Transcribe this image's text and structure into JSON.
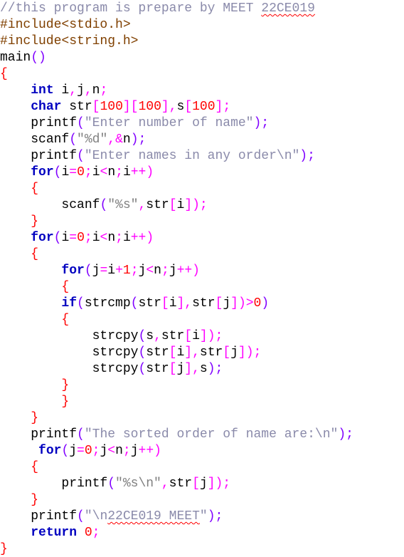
{
  "editor": {
    "lines": [
      {
        "tokens": [
          {
            "t": "//this program is prepare by MEET ",
            "c": "comment"
          },
          {
            "t": "22CE019",
            "c": "comment squiggle"
          }
        ]
      },
      {
        "tokens": [
          {
            "t": "#include<stdio.h>",
            "c": "preproc"
          }
        ]
      },
      {
        "tokens": [
          {
            "t": "#include<string.h>",
            "c": "preproc"
          }
        ]
      },
      {
        "tokens": [
          {
            "t": "main",
            "c": "ident"
          },
          {
            "t": "()",
            "c": "paren"
          }
        ]
      },
      {
        "tokens": [
          {
            "t": "{",
            "c": "brace"
          }
        ]
      },
      {
        "tokens": [
          {
            "t": "    ",
            "c": "ident"
          },
          {
            "t": "int",
            "c": "keyword"
          },
          {
            "t": " i",
            "c": "ident"
          },
          {
            "t": ",",
            "c": "op"
          },
          {
            "t": "j",
            "c": "ident"
          },
          {
            "t": ",",
            "c": "op"
          },
          {
            "t": "n",
            "c": "ident"
          },
          {
            "t": ";",
            "c": "op"
          }
        ]
      },
      {
        "tokens": [
          {
            "t": "    ",
            "c": "ident"
          },
          {
            "t": "char",
            "c": "keyword"
          },
          {
            "t": " str",
            "c": "ident"
          },
          {
            "t": "[",
            "c": "op"
          },
          {
            "t": "100",
            "c": "number"
          },
          {
            "t": "][",
            "c": "op"
          },
          {
            "t": "100",
            "c": "number"
          },
          {
            "t": "],",
            "c": "op"
          },
          {
            "t": "s",
            "c": "ident"
          },
          {
            "t": "[",
            "c": "op"
          },
          {
            "t": "100",
            "c": "number"
          },
          {
            "t": "];",
            "c": "op"
          }
        ]
      },
      {
        "tokens": [
          {
            "t": "    ",
            "c": "ident"
          },
          {
            "t": "printf",
            "c": "ident"
          },
          {
            "t": "(",
            "c": "paren"
          },
          {
            "t": "\"Enter number of name\"",
            "c": "string"
          },
          {
            "t": ");",
            "c": "paren"
          }
        ]
      },
      {
        "tokens": [
          {
            "t": "    ",
            "c": "ident"
          },
          {
            "t": "scanf",
            "c": "ident"
          },
          {
            "t": "(",
            "c": "paren"
          },
          {
            "t": "\"%d\"",
            "c": "string2"
          },
          {
            "t": ",&",
            "c": "op"
          },
          {
            "t": "n",
            "c": "ident"
          },
          {
            "t": ");",
            "c": "paren"
          }
        ]
      },
      {
        "tokens": [
          {
            "t": "    ",
            "c": "ident"
          },
          {
            "t": "printf",
            "c": "ident"
          },
          {
            "t": "(",
            "c": "paren"
          },
          {
            "t": "\"Enter names in any order\\n\"",
            "c": "string"
          },
          {
            "t": ");",
            "c": "paren"
          }
        ]
      },
      {
        "tokens": [
          {
            "t": "    ",
            "c": "ident"
          },
          {
            "t": "for",
            "c": "keyword"
          },
          {
            "t": "(",
            "c": "paren"
          },
          {
            "t": "i",
            "c": "ident"
          },
          {
            "t": "=",
            "c": "op"
          },
          {
            "t": "0",
            "c": "number"
          },
          {
            "t": ";",
            "c": "op"
          },
          {
            "t": "i",
            "c": "ident"
          },
          {
            "t": "<",
            "c": "op"
          },
          {
            "t": "n",
            "c": "ident"
          },
          {
            "t": ";",
            "c": "op"
          },
          {
            "t": "i",
            "c": "ident"
          },
          {
            "t": "++)",
            "c": "op"
          }
        ]
      },
      {
        "tokens": [
          {
            "t": "    ",
            "c": "ident"
          },
          {
            "t": "{",
            "c": "brace"
          }
        ]
      },
      {
        "tokens": [
          {
            "t": "        ",
            "c": "ident"
          },
          {
            "t": "scanf",
            "c": "ident"
          },
          {
            "t": "(",
            "c": "paren"
          },
          {
            "t": "\"%s\"",
            "c": "string2"
          },
          {
            "t": ",",
            "c": "op"
          },
          {
            "t": "str",
            "c": "ident"
          },
          {
            "t": "[",
            "c": "op"
          },
          {
            "t": "i",
            "c": "ident"
          },
          {
            "t": "]);",
            "c": "op"
          }
        ]
      },
      {
        "tokens": [
          {
            "t": "    ",
            "c": "ident"
          },
          {
            "t": "}",
            "c": "brace"
          }
        ]
      },
      {
        "tokens": [
          {
            "t": "    ",
            "c": "ident"
          },
          {
            "t": "for",
            "c": "keyword"
          },
          {
            "t": "(",
            "c": "paren"
          },
          {
            "t": "i",
            "c": "ident"
          },
          {
            "t": "=",
            "c": "op"
          },
          {
            "t": "0",
            "c": "number"
          },
          {
            "t": ";",
            "c": "op"
          },
          {
            "t": "i",
            "c": "ident"
          },
          {
            "t": "<",
            "c": "op"
          },
          {
            "t": "n",
            "c": "ident"
          },
          {
            "t": ";",
            "c": "op"
          },
          {
            "t": "i",
            "c": "ident"
          },
          {
            "t": "++)",
            "c": "op"
          }
        ]
      },
      {
        "tokens": [
          {
            "t": "    ",
            "c": "ident"
          },
          {
            "t": "{",
            "c": "brace"
          }
        ]
      },
      {
        "tokens": [
          {
            "t": "        ",
            "c": "ident"
          },
          {
            "t": "for",
            "c": "keyword"
          },
          {
            "t": "(",
            "c": "paren"
          },
          {
            "t": "j",
            "c": "ident"
          },
          {
            "t": "=",
            "c": "op"
          },
          {
            "t": "i",
            "c": "ident"
          },
          {
            "t": "+",
            "c": "op"
          },
          {
            "t": "1",
            "c": "number"
          },
          {
            "t": ";",
            "c": "op"
          },
          {
            "t": "j",
            "c": "ident"
          },
          {
            "t": "<",
            "c": "op"
          },
          {
            "t": "n",
            "c": "ident"
          },
          {
            "t": ";",
            "c": "op"
          },
          {
            "t": "j",
            "c": "ident"
          },
          {
            "t": "++)",
            "c": "op"
          }
        ]
      },
      {
        "tokens": [
          {
            "t": "        ",
            "c": "ident"
          },
          {
            "t": "{",
            "c": "brace"
          }
        ]
      },
      {
        "tokens": [
          {
            "t": "        ",
            "c": "ident"
          },
          {
            "t": "if",
            "c": "keyword"
          },
          {
            "t": "(",
            "c": "paren"
          },
          {
            "t": "strcmp",
            "c": "ident"
          },
          {
            "t": "(",
            "c": "paren"
          },
          {
            "t": "str",
            "c": "ident"
          },
          {
            "t": "[",
            "c": "op"
          },
          {
            "t": "i",
            "c": "ident"
          },
          {
            "t": "],",
            "c": "op"
          },
          {
            "t": "str",
            "c": "ident"
          },
          {
            "t": "[",
            "c": "op"
          },
          {
            "t": "j",
            "c": "ident"
          },
          {
            "t": "])>",
            "c": "op"
          },
          {
            "t": "0",
            "c": "number"
          },
          {
            "t": ")",
            "c": "paren"
          }
        ]
      },
      {
        "tokens": [
          {
            "t": "        ",
            "c": "ident"
          },
          {
            "t": "{",
            "c": "brace"
          }
        ]
      },
      {
        "tokens": [
          {
            "t": "            ",
            "c": "ident"
          },
          {
            "t": "strcpy",
            "c": "ident"
          },
          {
            "t": "(",
            "c": "paren"
          },
          {
            "t": "s",
            "c": "ident"
          },
          {
            "t": ",",
            "c": "op"
          },
          {
            "t": "str",
            "c": "ident"
          },
          {
            "t": "[",
            "c": "op"
          },
          {
            "t": "i",
            "c": "ident"
          },
          {
            "t": "]);",
            "c": "op"
          }
        ]
      },
      {
        "tokens": [
          {
            "t": "            ",
            "c": "ident"
          },
          {
            "t": "strcpy",
            "c": "ident"
          },
          {
            "t": "(",
            "c": "paren"
          },
          {
            "t": "str",
            "c": "ident"
          },
          {
            "t": "[",
            "c": "op"
          },
          {
            "t": "i",
            "c": "ident"
          },
          {
            "t": "],",
            "c": "op"
          },
          {
            "t": "str",
            "c": "ident"
          },
          {
            "t": "[",
            "c": "op"
          },
          {
            "t": "j",
            "c": "ident"
          },
          {
            "t": "]);",
            "c": "op"
          }
        ]
      },
      {
        "tokens": [
          {
            "t": "            ",
            "c": "ident"
          },
          {
            "t": "strcpy",
            "c": "ident"
          },
          {
            "t": "(",
            "c": "paren"
          },
          {
            "t": "str",
            "c": "ident"
          },
          {
            "t": "[",
            "c": "op"
          },
          {
            "t": "j",
            "c": "ident"
          },
          {
            "t": "],",
            "c": "op"
          },
          {
            "t": "s",
            "c": "ident"
          },
          {
            "t": ");",
            "c": "paren"
          }
        ]
      },
      {
        "tokens": [
          {
            "t": "        ",
            "c": "ident"
          },
          {
            "t": "}",
            "c": "brace"
          }
        ]
      },
      {
        "tokens": [
          {
            "t": "        ",
            "c": "ident"
          },
          {
            "t": "}",
            "c": "brace"
          }
        ]
      },
      {
        "tokens": [
          {
            "t": "    ",
            "c": "ident"
          },
          {
            "t": "}",
            "c": "brace"
          }
        ]
      },
      {
        "tokens": [
          {
            "t": "    ",
            "c": "ident"
          },
          {
            "t": "printf",
            "c": "ident"
          },
          {
            "t": "(",
            "c": "paren"
          },
          {
            "t": "\"The sorted order of name are:\\n\"",
            "c": "string"
          },
          {
            "t": ");",
            "c": "paren"
          }
        ]
      },
      {
        "tokens": [
          {
            "t": "     ",
            "c": "ident"
          },
          {
            "t": "for",
            "c": "keyword"
          },
          {
            "t": "(",
            "c": "paren"
          },
          {
            "t": "j",
            "c": "ident"
          },
          {
            "t": "=",
            "c": "op"
          },
          {
            "t": "0",
            "c": "number"
          },
          {
            "t": ";",
            "c": "op"
          },
          {
            "t": "j",
            "c": "ident"
          },
          {
            "t": "<",
            "c": "op"
          },
          {
            "t": "n",
            "c": "ident"
          },
          {
            "t": ";",
            "c": "op"
          },
          {
            "t": "j",
            "c": "ident"
          },
          {
            "t": "++)",
            "c": "op"
          }
        ]
      },
      {
        "tokens": [
          {
            "t": "    ",
            "c": "ident"
          },
          {
            "t": "{",
            "c": "brace"
          }
        ]
      },
      {
        "tokens": [
          {
            "t": "        ",
            "c": "ident"
          },
          {
            "t": "printf",
            "c": "ident"
          },
          {
            "t": "(",
            "c": "paren"
          },
          {
            "t": "\"%s\\n\"",
            "c": "string2"
          },
          {
            "t": ",",
            "c": "op"
          },
          {
            "t": "str",
            "c": "ident"
          },
          {
            "t": "[",
            "c": "op"
          },
          {
            "t": "j",
            "c": "ident"
          },
          {
            "t": "]);",
            "c": "op"
          }
        ]
      },
      {
        "tokens": [
          {
            "t": "    ",
            "c": "ident"
          },
          {
            "t": "}",
            "c": "brace"
          }
        ]
      },
      {
        "tokens": [
          {
            "t": "    ",
            "c": "ident"
          },
          {
            "t": "printf",
            "c": "ident"
          },
          {
            "t": "(",
            "c": "paren"
          },
          {
            "t": "\"\\n",
            "c": "string"
          },
          {
            "t": "22CE019 MEET",
            "c": "string squiggle"
          },
          {
            "t": "\"",
            "c": "string"
          },
          {
            "t": ");",
            "c": "paren"
          }
        ]
      },
      {
        "tokens": [
          {
            "t": "    ",
            "c": "ident"
          },
          {
            "t": "return",
            "c": "keyword"
          },
          {
            "t": " ",
            "c": "ident"
          },
          {
            "t": "0",
            "c": "number"
          },
          {
            "t": ";",
            "c": "op"
          }
        ]
      },
      {
        "tokens": [
          {
            "t": "}",
            "c": "brace"
          }
        ]
      }
    ]
  }
}
